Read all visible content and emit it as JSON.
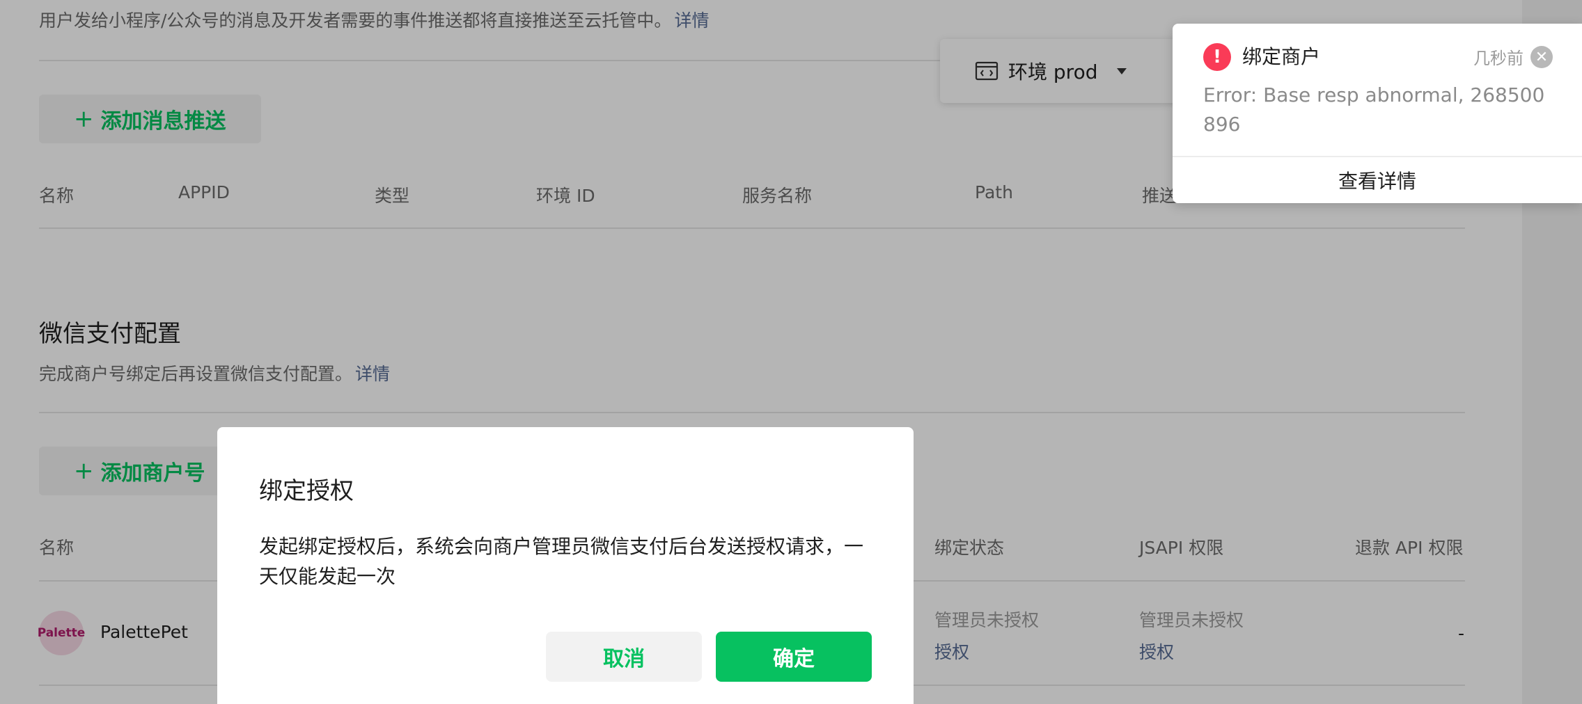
{
  "message_push": {
    "description": "用户发给小程序/公众号的消息及开发者需要的事件推送都将直接推送至云托管中。",
    "detail_link": "详情",
    "add_button": "添加消息推送",
    "columns": [
      "名称",
      "APPID",
      "类型",
      "环境 ID",
      "服务名称",
      "Path",
      "推送"
    ]
  },
  "env_selector": {
    "label": "环境 prod"
  },
  "wechat_pay": {
    "title": "微信支付配置",
    "description": "完成商户号绑定后再设置微信支付配置。",
    "detail_link": "详情",
    "add_button": "添加商户号",
    "columns": [
      "名称",
      "绑定状态",
      "JSAPI 权限",
      "退款 API 权限"
    ],
    "rows": [
      {
        "avatar_text": "Palette",
        "name": "PalettePet",
        "bind_status": "管理员未授权",
        "bind_action": "授权",
        "jsapi_status": "管理员未授权",
        "jsapi_action": "授权",
        "refund": "-"
      }
    ]
  },
  "dialog": {
    "title": "绑定授权",
    "body": "发起绑定授权后，系统会向商户管理员微信支付后台发送授权请求，一天仅能发起一次",
    "cancel": "取消",
    "confirm": "确定"
  },
  "notification": {
    "title": "绑定商户",
    "time": "几秒前",
    "message": "Error: Base resp abnormal, 268500896",
    "action": "查看详情",
    "icon": "error-icon"
  },
  "colors": {
    "brand_green": "#07c160",
    "link_blue": "#576b95",
    "error_red": "#fa3b57"
  }
}
